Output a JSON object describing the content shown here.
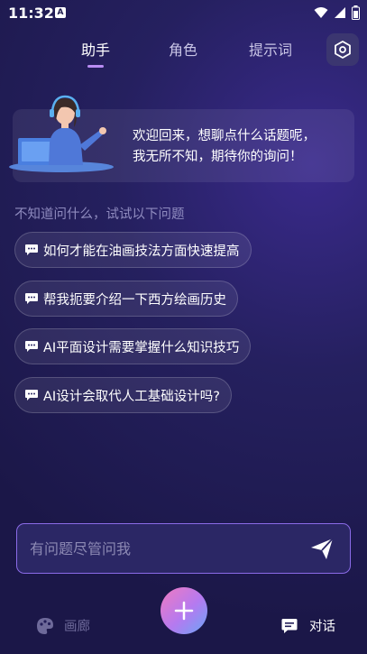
{
  "status_bar": {
    "time": "11:32",
    "badge": "A"
  },
  "tabs": [
    {
      "label": "助手",
      "active": true
    },
    {
      "label": "角色",
      "active": false
    },
    {
      "label": "提示词",
      "active": false
    }
  ],
  "welcome": {
    "line1": "欢迎回来，想聊点什么话题呢，",
    "line2": "我无所不知，期待你的询问！"
  },
  "suggestions": {
    "title": "不知道问什么，试试以下问题",
    "items": [
      "如何才能在油画技法方面快速提高",
      "帮我扼要介绍一下西方绘画历史",
      "AI平面设计需要掌握什么知识技巧",
      "AI设计会取代人工基础设计吗?"
    ]
  },
  "input": {
    "placeholder": "有问题尽管问我"
  },
  "bottom_nav": {
    "gallery_label": "画廊",
    "chat_label": "对话"
  },
  "colors": {
    "accent": "#b98cf3",
    "input_border": "#8b6be8",
    "bg": "#221d58"
  }
}
